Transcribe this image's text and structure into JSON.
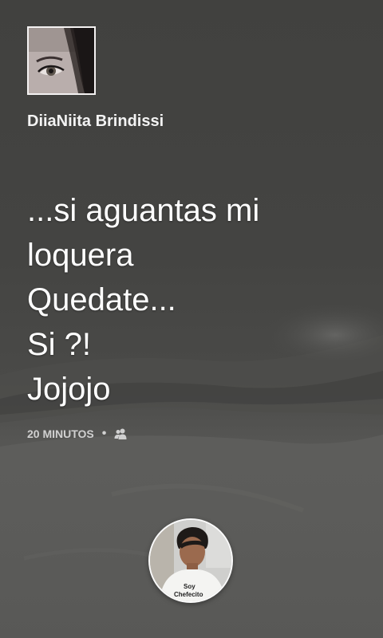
{
  "post": {
    "author": {
      "name": "DiiaNiita Brindissi",
      "avatar_icon": "profile-photo-icon"
    },
    "text_lines": [
      "...si aguantas mi",
      "loquera",
      "Quedate...",
      "Si ?!",
      "Jojojo"
    ],
    "meta": {
      "time": "20 MINUTOS",
      "separator": "•",
      "audience_icon": "friends-icon"
    }
  },
  "viewer": {
    "avatar_icon": "viewer-profile-photo-icon",
    "shirt_text_line1": "Soy",
    "shirt_text_line2": "Chefecito"
  },
  "colors": {
    "background": "#444442",
    "text": "#ffffff",
    "meta_text": "#d0d0d0"
  }
}
